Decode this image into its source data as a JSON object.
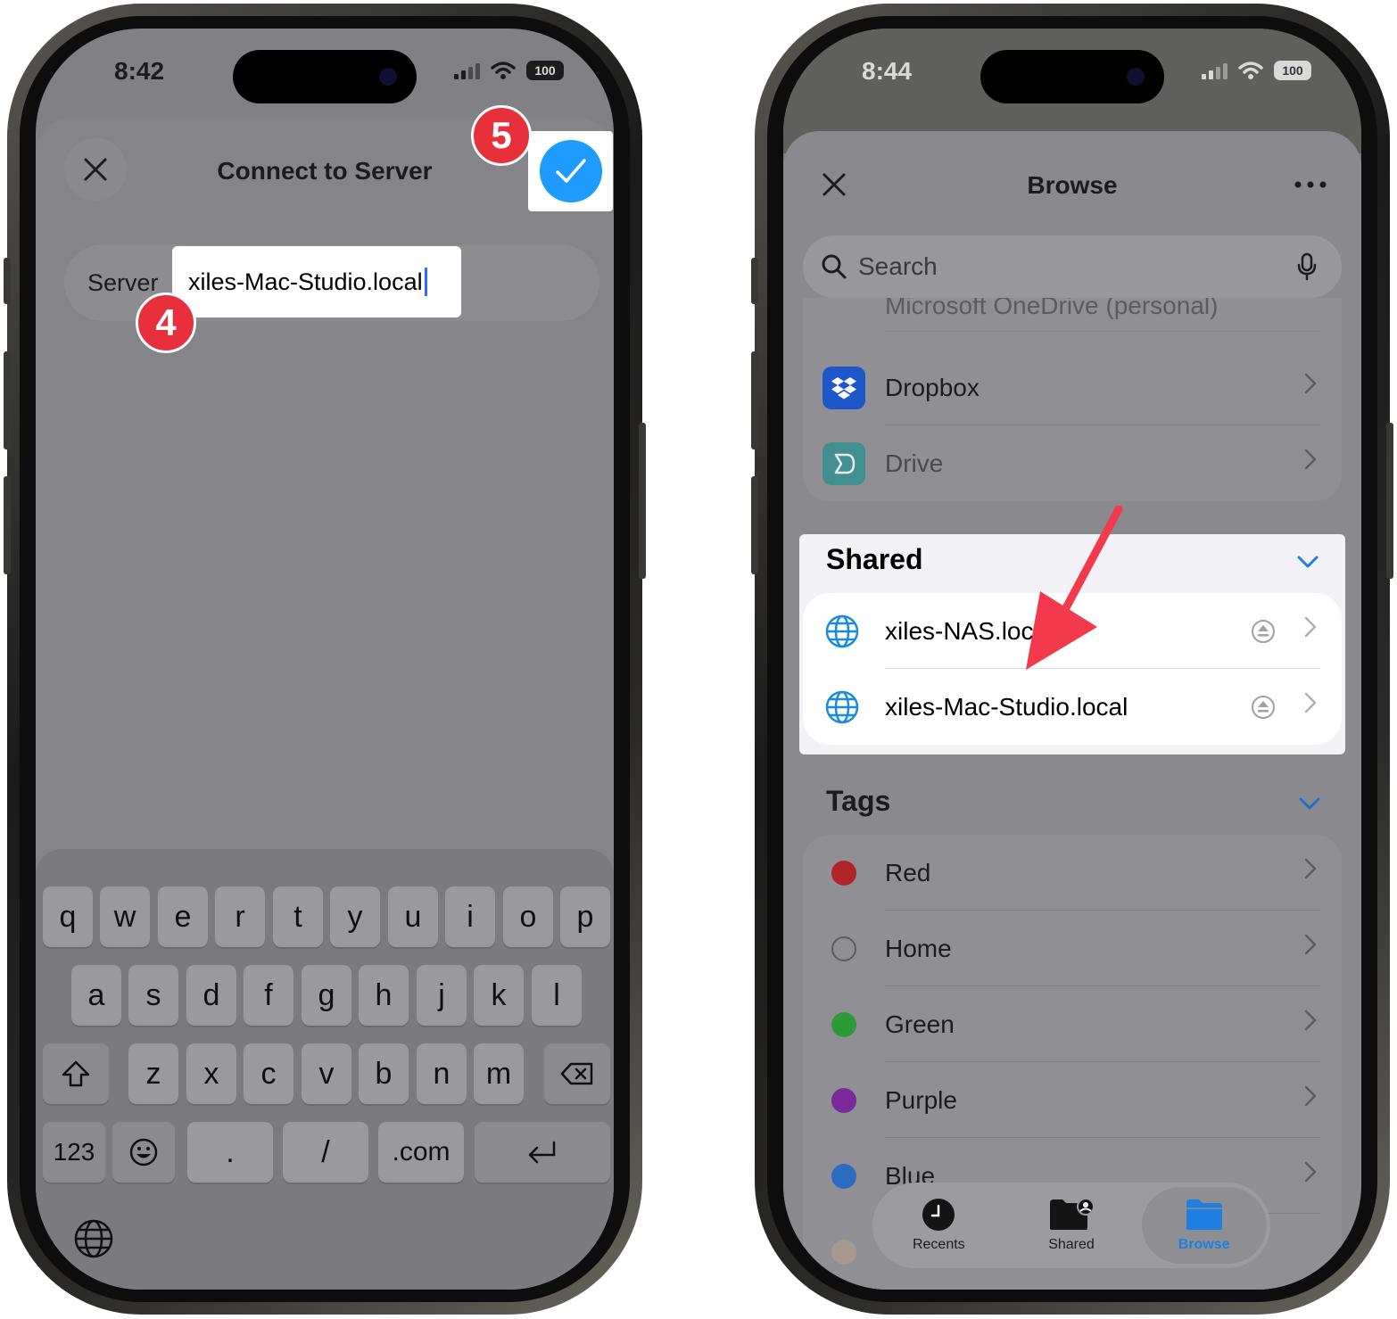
{
  "left": {
    "status_time": "8:42",
    "battery": "100",
    "title": "Connect to Server",
    "server_label": "Server",
    "server_value": "xiles-Mac-Studio.local",
    "step_badges": [
      "5",
      "4"
    ],
    "keyboard": {
      "row1": [
        "q",
        "w",
        "e",
        "r",
        "t",
        "y",
        "u",
        "i",
        "o",
        "p"
      ],
      "row2": [
        "a",
        "s",
        "d",
        "f",
        "g",
        "h",
        "j",
        "k",
        "l"
      ],
      "row3": [
        "z",
        "x",
        "c",
        "v",
        "b",
        "n",
        "m"
      ],
      "numbers_key": "123",
      "dot_key": ".",
      "slash_key": "/",
      "dotcom_key": ".com"
    }
  },
  "right": {
    "status_time": "8:44",
    "battery": "100",
    "title": "Browse",
    "search_placeholder": "Search",
    "locations": [
      {
        "label": "Microsoft OneDrive (personal)",
        "icon": "onedrive-icon"
      },
      {
        "label": "Dropbox",
        "icon": "dropbox-icon"
      },
      {
        "label": "Drive",
        "icon": "drive-icon"
      }
    ],
    "shared_header": "Shared",
    "shared_items": [
      {
        "label": "xiles-NAS.local"
      },
      {
        "label": "xiles-Mac-Studio.local"
      }
    ],
    "tags_header": "Tags",
    "tags": [
      {
        "label": "Red",
        "color": "#b0242a"
      },
      {
        "label": "Home",
        "color": ""
      },
      {
        "label": "Green",
        "color": "#2d9a3a"
      },
      {
        "label": "Purple",
        "color": "#7a2a9a"
      },
      {
        "label": "Blue",
        "color": "#2b6cc0"
      }
    ],
    "tabs": [
      {
        "label": "Recents",
        "icon": "clock-icon"
      },
      {
        "label": "Shared",
        "icon": "shared-folder-icon"
      },
      {
        "label": "Browse",
        "icon": "folder-icon"
      }
    ],
    "accent_color": "#1f7fe0",
    "annotation_arrow_color": "#f23a4c"
  }
}
